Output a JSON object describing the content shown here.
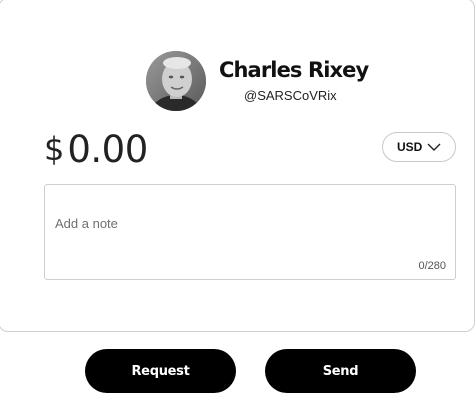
{
  "recipient": {
    "name": "Charles Rixey",
    "handle": "@SARSCoVRix",
    "avatar_alt": "avatar"
  },
  "payment": {
    "currency_symbol": "$",
    "amount": "0.00",
    "currency_code": "USD",
    "currency_icon": "chevron-down-icon"
  },
  "note": {
    "placeholder": "Add a note",
    "value": "",
    "counter": "0/280"
  },
  "actions": {
    "request_label": "Request",
    "send_label": "Send"
  },
  "colors": {
    "button_background": "#000000",
    "button_text": "#ffffff",
    "border": "#cfcfcf"
  }
}
